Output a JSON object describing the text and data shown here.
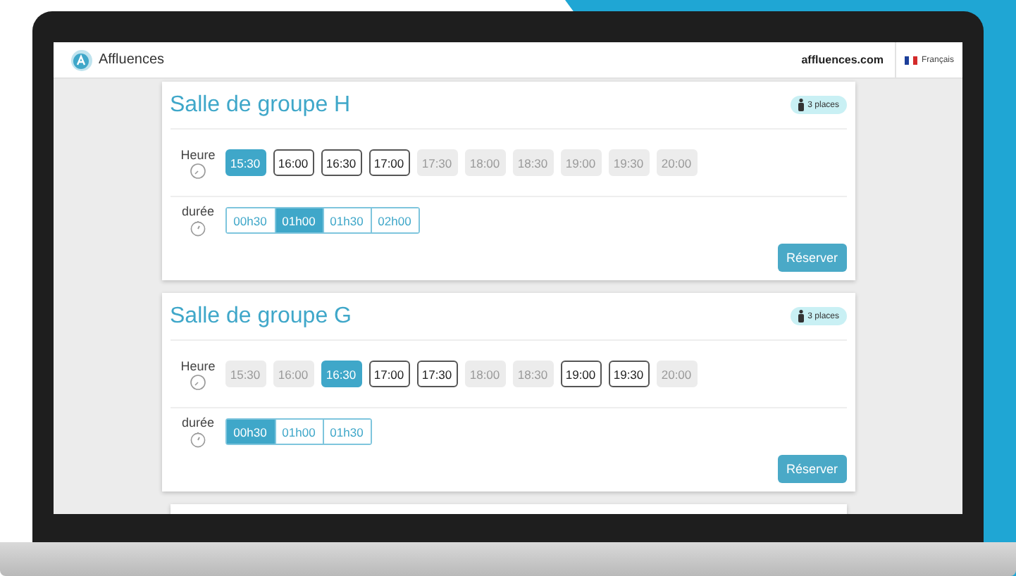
{
  "header": {
    "brand": "Affluences",
    "site": "affluences.com",
    "language": "Français"
  },
  "rooms": [
    {
      "title": "Salle de groupe H",
      "capacity": "3 places",
      "hour_label": "Heure",
      "duration_label": "durée",
      "button": "Réserver",
      "slots": [
        {
          "time": "15:30",
          "selected": true,
          "disabled": false
        },
        {
          "time": "16:00",
          "selected": false,
          "disabled": false
        },
        {
          "time": "16:30",
          "selected": false,
          "disabled": false
        },
        {
          "time": "17:00",
          "selected": false,
          "disabled": false
        },
        {
          "time": "17:30",
          "selected": false,
          "disabled": true
        },
        {
          "time": "18:00",
          "selected": false,
          "disabled": true
        },
        {
          "time": "18:30",
          "selected": false,
          "disabled": true
        },
        {
          "time": "19:00",
          "selected": false,
          "disabled": true
        },
        {
          "time": "19:30",
          "selected": false,
          "disabled": true
        },
        {
          "time": "20:00",
          "selected": false,
          "disabled": true
        }
      ],
      "durations": [
        {
          "label": "00h30",
          "selected": false
        },
        {
          "label": "01h00",
          "selected": true
        },
        {
          "label": "01h30",
          "selected": false
        },
        {
          "label": "02h00",
          "selected": false
        }
      ]
    },
    {
      "title": "Salle de groupe G",
      "capacity": "3 places",
      "hour_label": "Heure",
      "duration_label": "durée",
      "button": "Réserver",
      "slots": [
        {
          "time": "15:30",
          "selected": false,
          "disabled": true
        },
        {
          "time": "16:00",
          "selected": false,
          "disabled": true
        },
        {
          "time": "16:30",
          "selected": true,
          "disabled": false
        },
        {
          "time": "17:00",
          "selected": false,
          "disabled": false
        },
        {
          "time": "17:30",
          "selected": false,
          "disabled": false
        },
        {
          "time": "18:00",
          "selected": false,
          "disabled": true
        },
        {
          "time": "18:30",
          "selected": false,
          "disabled": true
        },
        {
          "time": "19:00",
          "selected": false,
          "disabled": false
        },
        {
          "time": "19:30",
          "selected": false,
          "disabled": false
        },
        {
          "time": "20:00",
          "selected": false,
          "disabled": true
        }
      ],
      "durations": [
        {
          "label": "00h30",
          "selected": true
        },
        {
          "label": "01h00",
          "selected": false
        },
        {
          "label": "01h30",
          "selected": false
        }
      ]
    }
  ]
}
